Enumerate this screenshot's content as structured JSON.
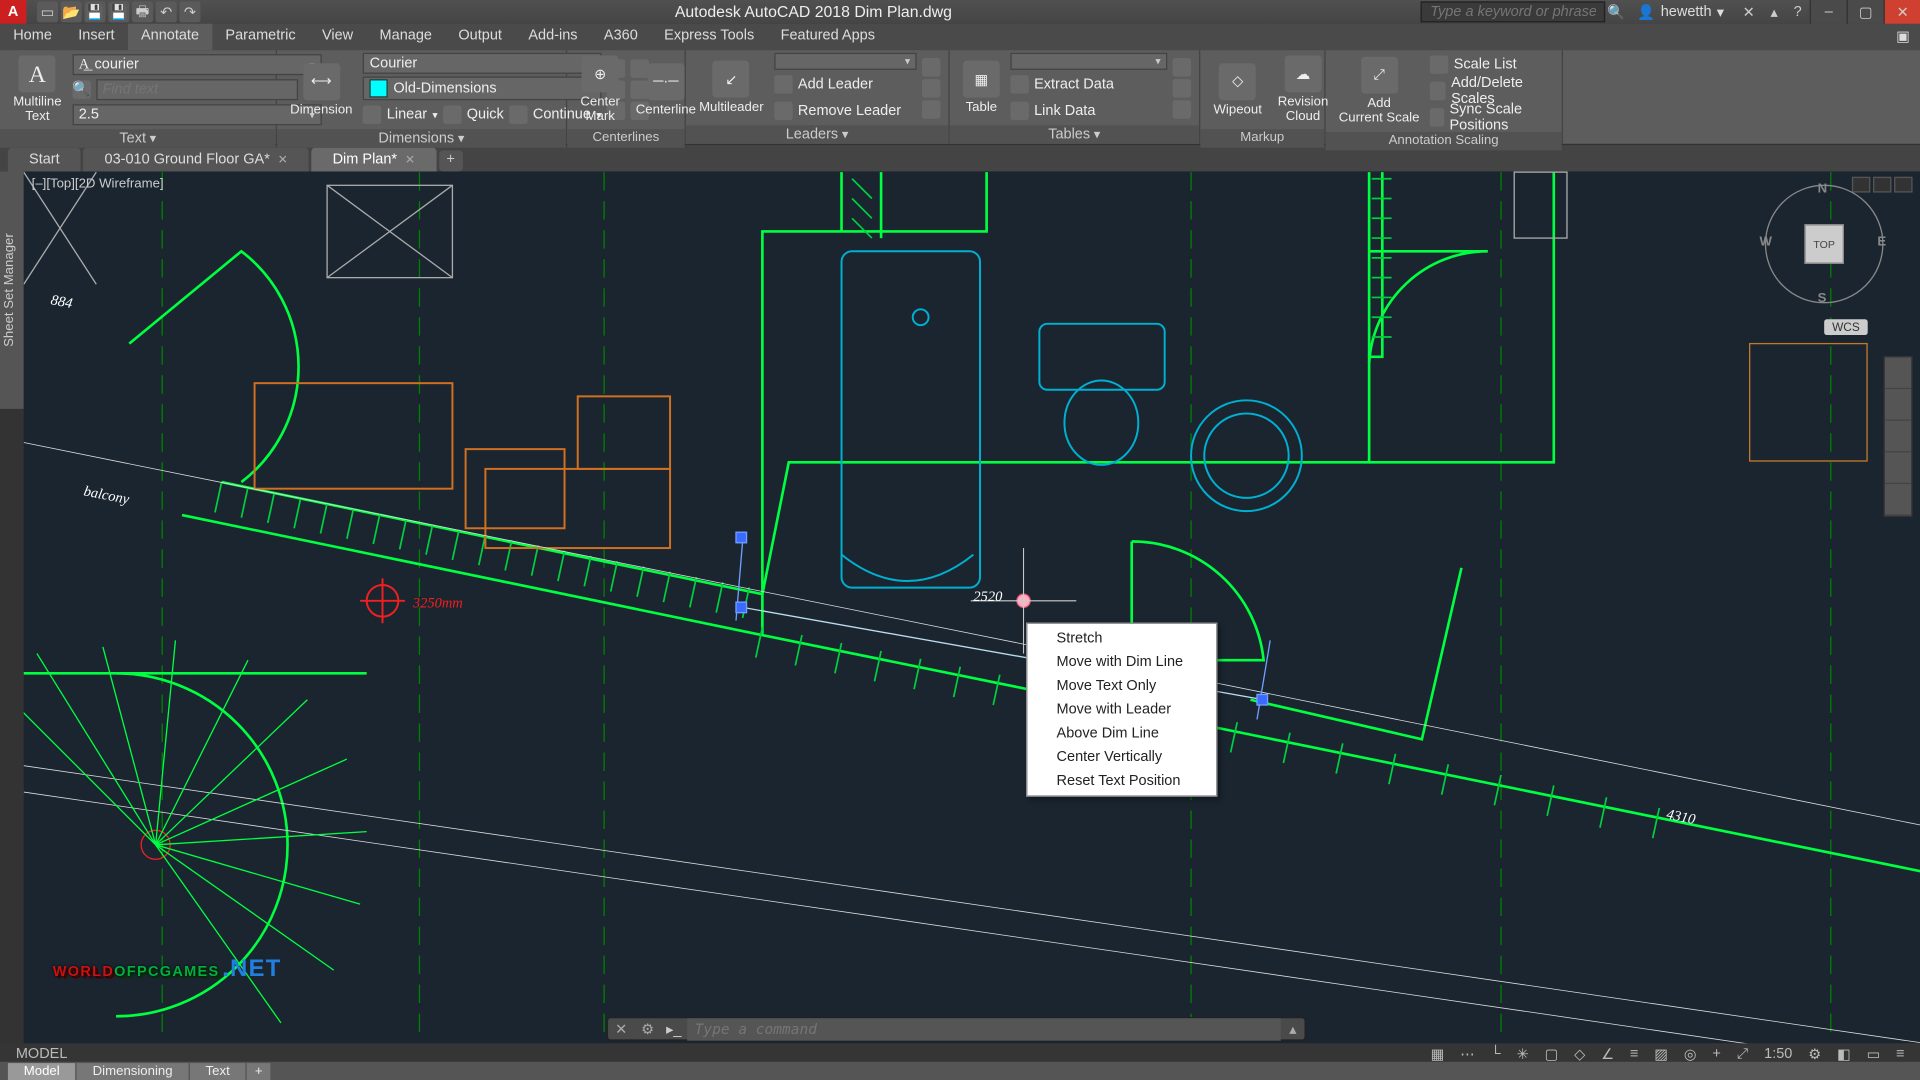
{
  "title": "Autodesk AutoCAD 2018   Dim Plan.dwg",
  "search_placeholder": "Type a keyword or phrase",
  "user": "hewetth",
  "menu_tabs": [
    "Home",
    "Insert",
    "Annotate",
    "Parametric",
    "View",
    "Manage",
    "Output",
    "Add-ins",
    "A360",
    "Express Tools",
    "Featured Apps"
  ],
  "active_menu": 2,
  "text_panel": {
    "label": "Multiline\nText",
    "font": "courier",
    "find_ph": "Find text",
    "height": "2.5",
    "title": "Text"
  },
  "dim_panel": {
    "label": "Dimension",
    "style_font": "Courier",
    "style": "Old-Dimensions",
    "linear": "Linear",
    "quick": "Quick",
    "continue": "Continue",
    "title": "Dimensions"
  },
  "center_panel": {
    "mark": "Center\nMark",
    "line": "Centerline",
    "title": "Centerlines"
  },
  "leader_panel": {
    "multi": "Multileader",
    "add": "Add Leader",
    "remove": "Remove Leader",
    "title": "Leaders"
  },
  "table_panel": {
    "label": "Table",
    "extract": "Extract Data",
    "link": "Link Data",
    "title": "Tables"
  },
  "markup_panel": {
    "wipeout": "Wipeout",
    "cloud": "Revision\nCloud",
    "title": "Markup"
  },
  "scale_panel": {
    "add": "Add\nCurrent Scale",
    "list": "Scale List",
    "adddel": "Add/Delete Scales",
    "sync": "Sync Scale Positions",
    "title": "Annotation Scaling"
  },
  "file_tabs": [
    {
      "name": "Start"
    },
    {
      "name": "03-010 Ground Floor GA*"
    },
    {
      "name": "Dim Plan*"
    }
  ],
  "active_file": 2,
  "viewport_label": "[–][Top][2D Wireframe]",
  "viewcube_top": "TOP",
  "compass": {
    "n": "N",
    "e": "E",
    "s": "S",
    "w": "W"
  },
  "wcs": "WCS",
  "canvas": {
    "balcony": "balcony",
    "d884": "884",
    "d2520": "2520",
    "d4310": "4310",
    "red_dim": "3250mm"
  },
  "context_menu": [
    "Stretch",
    "Move with Dim Line",
    "Move Text Only",
    "Move with Leader",
    "Above Dim Line",
    "Center Vertically",
    "Reset Text Position"
  ],
  "cmd_placeholder": "Type a command",
  "status": {
    "model": "MODEL",
    "scale": "1:50"
  },
  "layout_tabs": [
    "Model",
    "Dimensioning",
    "Text"
  ],
  "active_layout": 0,
  "watermark": {
    "a": "WORLD",
    "b": "OFPCGAMES",
    "c": ".NET"
  }
}
